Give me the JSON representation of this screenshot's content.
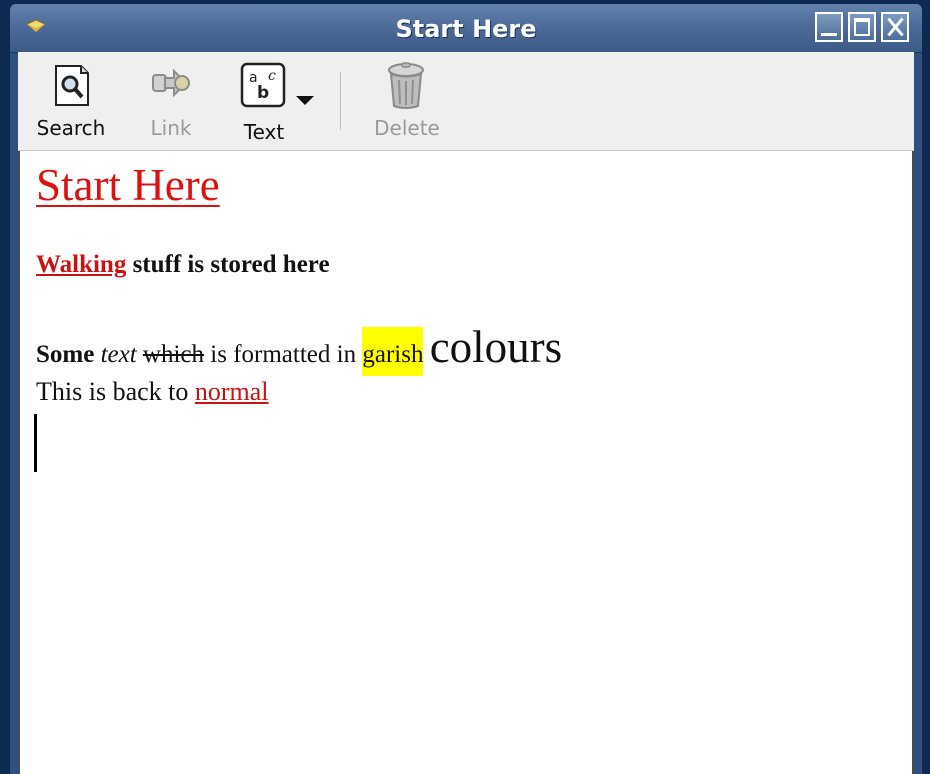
{
  "window": {
    "title": "Start Here"
  },
  "toolbar": {
    "search_label": "Search",
    "link_label": "Link",
    "text_label": "Text",
    "delete_label": "Delete"
  },
  "document": {
    "heading": "Start Here",
    "line2_link": "Walking",
    "line2_rest": " stuff is stored here",
    "line3": {
      "bold": "Some",
      "italic": "text",
      "strike": "which",
      "plain": "is formatted in",
      "highlight": "garish",
      "big": "colours"
    },
    "line4_plain": "This is back to ",
    "line4_link": "normal"
  },
  "colors": {
    "link": "#cc1111",
    "highlight": "#ffff00",
    "titlebar": "#4d6c99"
  }
}
